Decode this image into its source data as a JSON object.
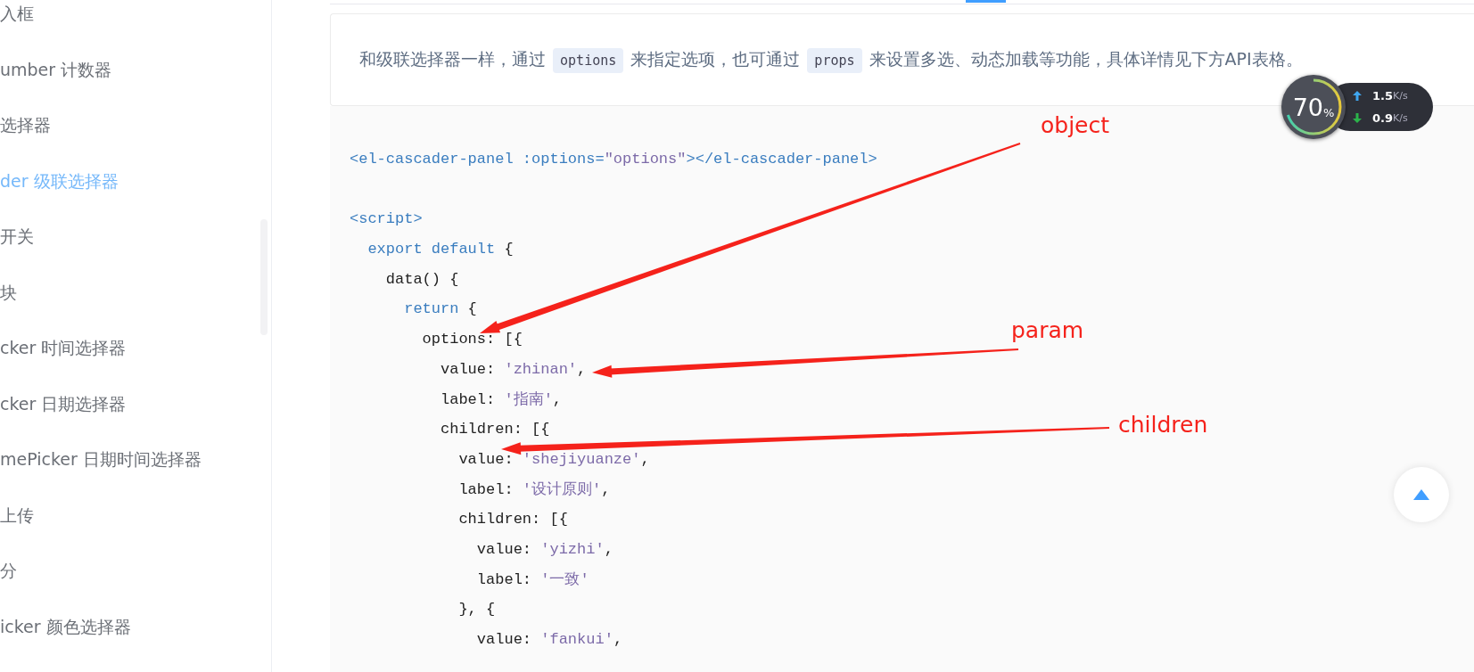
{
  "sidebar": {
    "items": [
      {
        "label": "入框",
        "selected": false
      },
      {
        "label": "umber 计数器",
        "selected": false
      },
      {
        "label": "选择器",
        "selected": false
      },
      {
        "label": "der 级联选择器",
        "selected": true
      },
      {
        "label": "开关",
        "selected": false
      },
      {
        "label": "块",
        "selected": false
      },
      {
        "label": "cker 时间选择器",
        "selected": false
      },
      {
        "label": "cker 日期选择器",
        "selected": false
      },
      {
        "label": "mePicker 日期时间选择器",
        "selected": false
      },
      {
        "label": "上传",
        "selected": false
      },
      {
        "label": "分",
        "selected": false
      },
      {
        "label": "icker 颜色选择器",
        "selected": false
      }
    ]
  },
  "description": [
    {
      "kind": "text",
      "text": "和级联选择器一样，通过 "
    },
    {
      "kind": "code",
      "text": "options"
    },
    {
      "kind": "text",
      "text": " 来指定选项，也可通过 "
    },
    {
      "kind": "code",
      "text": "props"
    },
    {
      "kind": "text",
      "text": " 来设置多选、动态加载等功能，具体详情见下方API表格。"
    }
  ],
  "code_lines": [
    [
      {
        "kind": "tag",
        "text": "<el-cascader-panel :options="
      },
      {
        "kind": "string",
        "text": "\"options\""
      },
      {
        "kind": "tag",
        "text": "></el-cascader-panel>"
      }
    ],
    [
      {
        "kind": "tag",
        "text": "<script>",
        "spaced": true
      }
    ],
    [
      {
        "kind": "keyword",
        "text": "  export default"
      },
      {
        "kind": "plain",
        "text": " {"
      }
    ],
    [
      {
        "kind": "plain",
        "text": "    data() {"
      }
    ],
    [
      {
        "kind": "keyword",
        "text": "      return"
      },
      {
        "kind": "plain",
        "text": " {"
      }
    ],
    [
      {
        "kind": "plain",
        "text": "        options: [{"
      }
    ],
    [
      {
        "kind": "plain",
        "text": "          value: "
      },
      {
        "kind": "string",
        "text": "'zhinan'"
      },
      {
        "kind": "plain",
        "text": ","
      }
    ],
    [
      {
        "kind": "plain",
        "text": "          label: "
      },
      {
        "kind": "string",
        "text": "'指南'"
      },
      {
        "kind": "plain",
        "text": ","
      }
    ],
    [
      {
        "kind": "plain",
        "text": "          children: [{"
      }
    ],
    [
      {
        "kind": "plain",
        "text": "            value: "
      },
      {
        "kind": "string",
        "text": "'shejiyuanze'"
      },
      {
        "kind": "plain",
        "text": ","
      }
    ],
    [
      {
        "kind": "plain",
        "text": "            label: "
      },
      {
        "kind": "string",
        "text": "'设计原则'"
      },
      {
        "kind": "plain",
        "text": ","
      }
    ],
    [
      {
        "kind": "plain",
        "text": "            children: [{"
      }
    ],
    [
      {
        "kind": "plain",
        "text": "              value: "
      },
      {
        "kind": "string",
        "text": "'yizhi'"
      },
      {
        "kind": "plain",
        "text": ","
      }
    ],
    [
      {
        "kind": "plain",
        "text": "              label: "
      },
      {
        "kind": "string",
        "text": "'一致'"
      }
    ],
    [
      {
        "kind": "plain",
        "text": "            }, {"
      }
    ],
    [
      {
        "kind": "plain",
        "text": "              value: "
      },
      {
        "kind": "string",
        "text": "'fankui'"
      },
      {
        "kind": "plain",
        "text": ","
      }
    ]
  ],
  "annotations": [
    {
      "label": "object"
    },
    {
      "label": "param"
    },
    {
      "label": "children"
    }
  ],
  "network_widget": {
    "percent": "70",
    "percent_unit": "%",
    "level": 0.7,
    "upload": {
      "value": "1.5",
      "unit": "K/s"
    },
    "download": {
      "value": "0.9",
      "unit": "K/s"
    }
  }
}
